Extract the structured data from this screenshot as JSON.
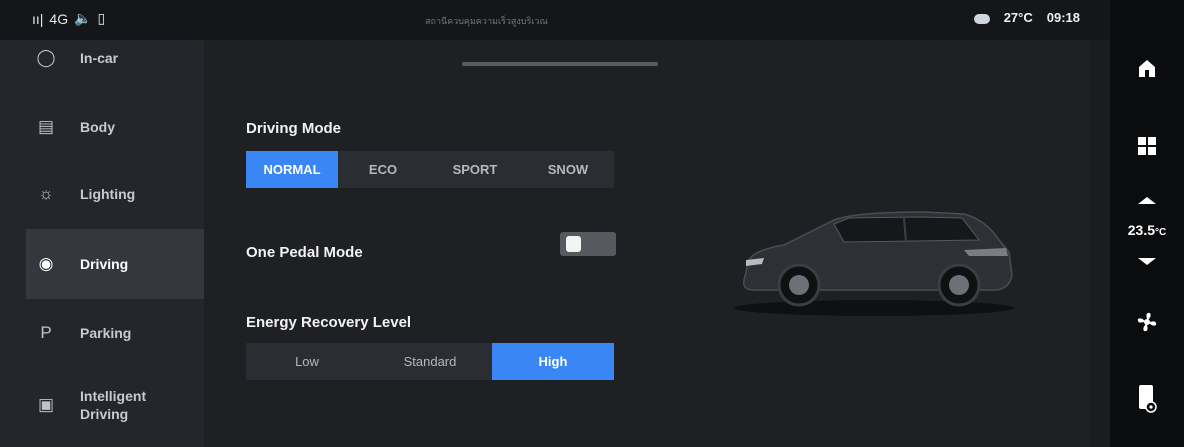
{
  "status_bar": {
    "signal": "ıı|",
    "network": "4G",
    "center_text": "สถานีควบคุมความเร็วสูงบริเวณ",
    "temperature": "27°C",
    "time": "09:18"
  },
  "sidebar": {
    "items": [
      {
        "label": "In-car",
        "icon": "car-seat-icon"
      },
      {
        "label": "Body",
        "icon": "car-body-icon"
      },
      {
        "label": "Lighting",
        "icon": "sun-icon"
      },
      {
        "label": "Driving",
        "icon": "steering-wheel-icon",
        "active": true
      },
      {
        "label": "Parking",
        "icon": "parking-icon"
      },
      {
        "label": "Intelligent Driving",
        "icon": "intelligent-driving-icon"
      }
    ]
  },
  "driving_mode": {
    "title": "Driving Mode",
    "options": [
      "NORMAL",
      "ECO",
      "SPORT",
      "SNOW"
    ],
    "selected": "NORMAL"
  },
  "one_pedal": {
    "title": "One Pedal Mode",
    "enabled": false
  },
  "energy_recovery": {
    "title": "Energy Recovery Level",
    "options": [
      "Low",
      "Standard",
      "High"
    ],
    "selected": "High"
  },
  "dock": {
    "temperature": "23.5",
    "temperature_unit": "°C"
  },
  "colors": {
    "accent": "#3a86f4",
    "background": "#1e2024",
    "sidebar": "#23262b"
  }
}
